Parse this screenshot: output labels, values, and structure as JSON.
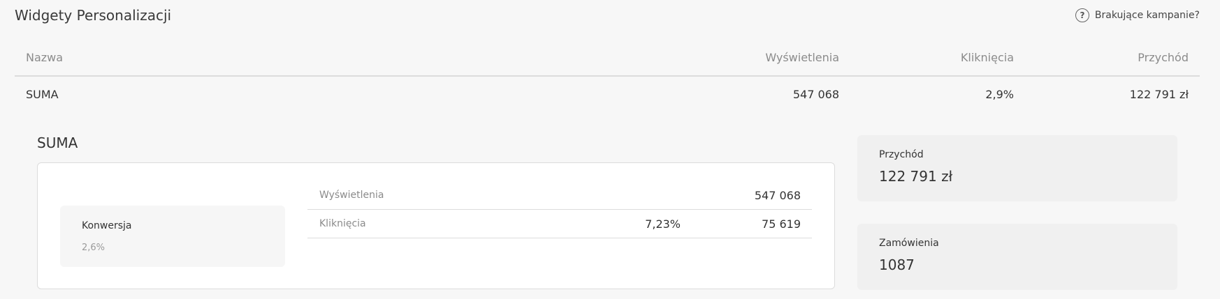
{
  "header": {
    "title": "Widgety Personalizacji",
    "help_label": "Brakujące kampanie?",
    "help_icon": "question-circle-icon"
  },
  "table": {
    "columns": [
      "Nazwa",
      "Wyświetlenia",
      "Kliknięcia",
      "Przychód"
    ],
    "rows": [
      {
        "name": "SUMA",
        "views": "547 068",
        "clicks": "2,9%",
        "revenue": "122 791 zł"
      }
    ]
  },
  "details": {
    "title": "SUMA",
    "conversion": {
      "label": "Konwersja",
      "value": "2,6%"
    },
    "stats": [
      {
        "label": "Wyświetlenia",
        "pct": "",
        "value": "547 068"
      },
      {
        "label": "Kliknięcia",
        "pct": "7,23%",
        "value": "75 619"
      }
    ],
    "metrics": {
      "revenue": {
        "label": "Przychód",
        "value": "122 791 zł"
      },
      "orders": {
        "label": "Zamówienia",
        "value": "1087"
      }
    }
  }
}
